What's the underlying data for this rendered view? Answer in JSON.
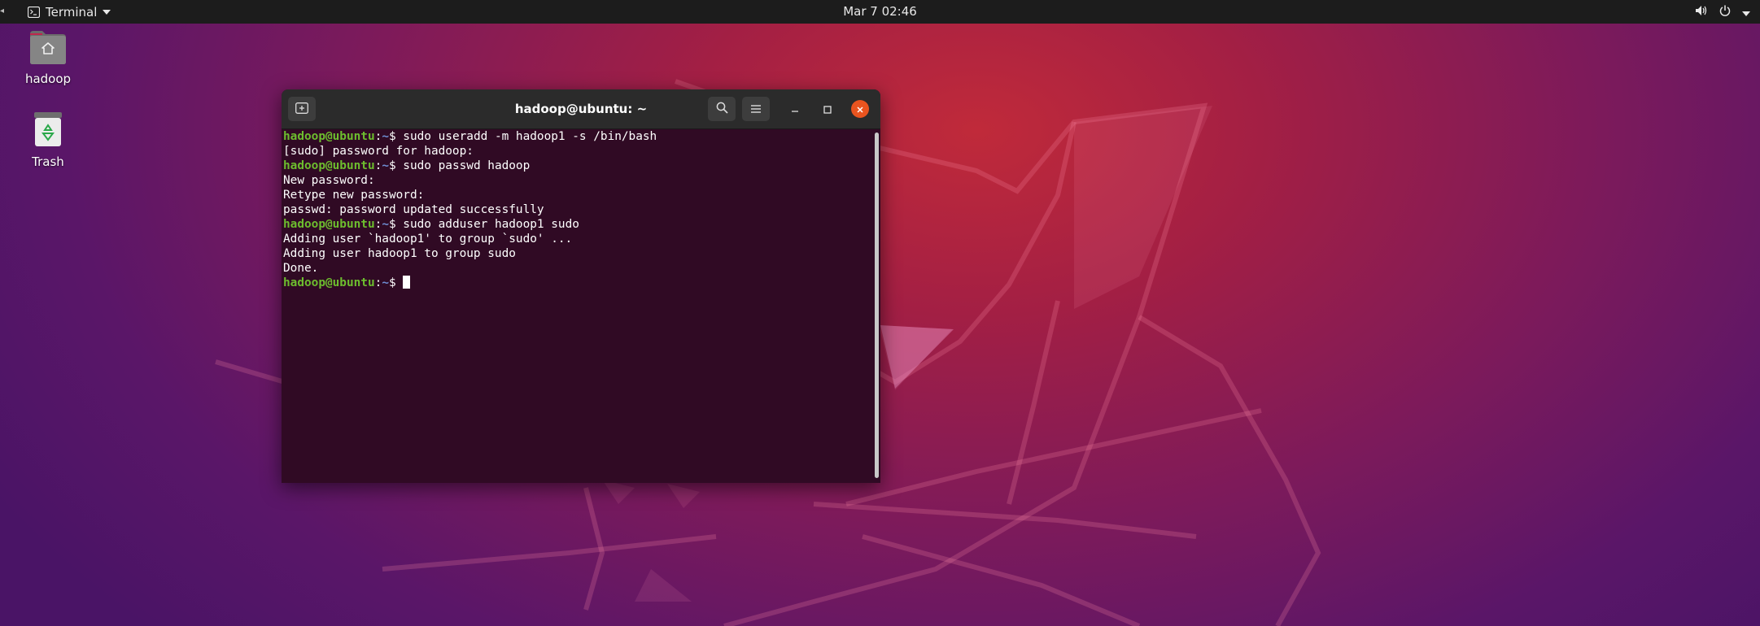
{
  "topbar": {
    "app_name": "Terminal",
    "clock": "Mar 7  02:46"
  },
  "desktop": {
    "home_label": "hadoop",
    "trash_label": "Trash"
  },
  "terminal": {
    "title": "hadoop@ubuntu: ~",
    "lines": [
      {
        "user": "hadoop@ubuntu",
        "path": "~",
        "cmd": "sudo useradd -m hadoop1 -s /bin/bash"
      },
      {
        "out": "[sudo] password for hadoop:"
      },
      {
        "user": "hadoop@ubuntu",
        "path": "~",
        "cmd": "sudo passwd hadoop"
      },
      {
        "out": "New password:"
      },
      {
        "out": "Retype new password:"
      },
      {
        "out": "passwd: password updated successfully"
      },
      {
        "user": "hadoop@ubuntu",
        "path": "~",
        "cmd": "sudo adduser hadoop1 sudo"
      },
      {
        "out": "Adding user `hadoop1' to group `sudo' ..."
      },
      {
        "out": "Adding user hadoop1 to group sudo"
      },
      {
        "out": "Done."
      },
      {
        "user": "hadoop@ubuntu",
        "path": "~",
        "cmd": "",
        "cursor": true
      }
    ]
  },
  "colors": {
    "terminal_bg": "#300a24",
    "prompt_user": "#6dbd2e",
    "prompt_path": "#6f8fd4",
    "close_button": "#e9541f",
    "topbar_bg": "#1c1c1c"
  },
  "icons": [
    "terminal-icon",
    "dropdown-caret-icon",
    "volume-icon",
    "power-icon",
    "home-folder-icon",
    "trash-icon",
    "new-tab-icon",
    "search-icon",
    "hamburger-menu-icon",
    "minimize-icon",
    "maximize-icon",
    "close-icon"
  ]
}
